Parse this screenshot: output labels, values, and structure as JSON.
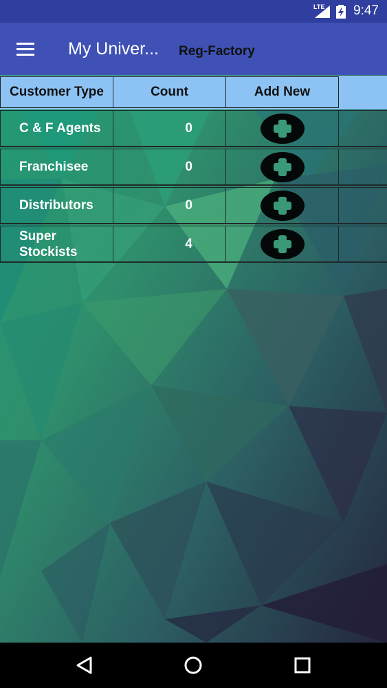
{
  "status_bar": {
    "time": "9:47",
    "network": "LTE",
    "icons": [
      "signal-icon",
      "battery-charging-icon"
    ]
  },
  "app_bar": {
    "menu_icon": "hamburger-menu-icon",
    "title": "My Univer...",
    "subtitle": "Reg-Factory",
    "background_color": "#3f51b5"
  },
  "table": {
    "headers": {
      "customer_type": "Customer Type",
      "count": "Count",
      "add_new": "Add New"
    },
    "header_color": "#8cc3f4",
    "rows": [
      {
        "type": "C & F Agents",
        "count": "0",
        "add_icon": "add-circle-icon"
      },
      {
        "type": "Franchisee",
        "count": "0",
        "add_icon": "add-circle-icon"
      },
      {
        "type": "Distributors",
        "count": "0",
        "add_icon": "add-circle-icon"
      },
      {
        "type": "Super Stockists",
        "count": "4",
        "add_icon": "add-circle-icon"
      }
    ]
  },
  "nav_bar": {
    "buttons": [
      "back-icon",
      "home-icon",
      "recents-icon"
    ]
  },
  "colors": {
    "status_bar": "#303f9f",
    "nav_bar": "#000000",
    "add_button": "#050808",
    "plus_sign": "#3a9a78"
  }
}
